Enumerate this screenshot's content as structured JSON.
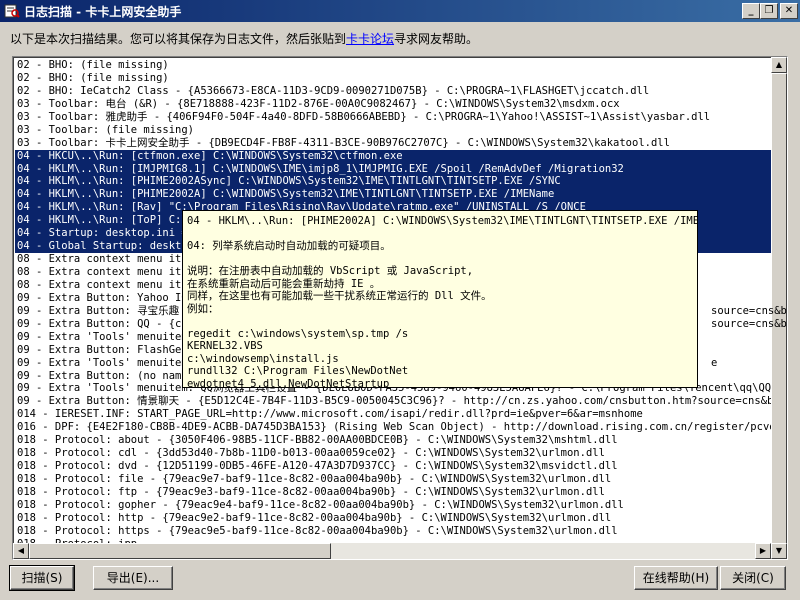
{
  "window": {
    "title": "日志扫描 - 卡卡上网安全助手",
    "minimize_label": "_",
    "restore_label": "❐",
    "close_label": "✕"
  },
  "intro": {
    "text_before": "以下是本次扫描结果。您可以将其保存为日志文件，然后张贴到",
    "link": "卡卡论坛",
    "text_after": "寻求网友帮助。"
  },
  "log_rows": [
    {
      "text": "02 - BHO:  (file missing)",
      "selected": false
    },
    {
      "text": "02 - BHO:  (file missing)",
      "selected": false
    },
    {
      "text": "02 - BHO: IeCatch2 Class - {A5366673-E8CA-11D3-9CD9-0090271D075B} - C:\\PROGRA~1\\FLASHGET\\jccatch.dll",
      "selected": false
    },
    {
      "text": "03 - Toolbar: 电台 (&R) - {8E718888-423F-11D2-876E-00A0C9082467} - C:\\WINDOWS\\System32\\msdxm.ocx",
      "selected": false
    },
    {
      "text": "03 - Toolbar: 雅虎助手 - {406F94F0-504F-4a40-8DFD-58B0666ABEBD} - C:\\PROGRA~1\\Yahoo!\\ASSIST~1\\Assist\\yasbar.dll",
      "selected": false
    },
    {
      "text": "03 - Toolbar:  (file missing)",
      "selected": false
    },
    {
      "text": "03 - Toolbar: 卡卡上网安全助手 - {DB9ECD4F-FB8F-4311-B3CE-90B976C2707C} - C:\\WINDOWS\\System32\\kakatool.dll",
      "selected": false
    },
    {
      "text": "04 - HKCU\\..\\Run: [ctfmon.exe] C:\\WINDOWS\\System32\\ctfmon.exe",
      "selected": true
    },
    {
      "text": "04 - HKLM\\..\\Run: [IMJPMIG8.1] C:\\WINDOWS\\IME\\imjp8_1\\IMJPMIG.EXE /Spoil /RemAdvDef /Migration32",
      "selected": true
    },
    {
      "text": "04 - HKLM\\..\\Run: [PHIME2002ASync] C:\\WINDOWS\\System32\\IME\\TINTLGNT\\TINTSETP.EXE /SYNC",
      "selected": true
    },
    {
      "text": "04 - HKLM\\..\\Run: [PHIME2002A] C:\\WINDOWS\\System32\\IME\\TINTLGNT\\TINTSETP.EXE /IMEName",
      "selected": true
    },
    {
      "text": "04 - HKLM\\..\\Run: [Rav] \"C:\\Program Files\\Rising\\Rav\\Update\\ratmp.exe\" /UNINSTALL /S /ONCE",
      "selected": true
    },
    {
      "text": "04 - HKLM\\..\\Run: [ToP] C:\\",
      "selected": true
    },
    {
      "text": "04 - Startup: desktop.ini =",
      "selected": true
    },
    {
      "text": "04 - Global Startup: deskto",
      "selected": true
    },
    {
      "text": "08 - Extra context menu ite",
      "selected": false
    },
    {
      "text": "08 - Extra context menu ite",
      "selected": false
    },
    {
      "text": "08 - Extra context menu ite",
      "selected": false
    },
    {
      "text": "09 - Extra Button: Yahoo IG",
      "selected": false
    },
    {
      "text": "09 - Extra Button: 寻宝乐趣",
      "selected": false
    },
    {
      "text": "09 - Extra Button: QQ - {c9",
      "selected": false
    },
    {
      "text": "09 - Extra 'Tools' menuitem",
      "selected": false
    },
    {
      "text": "09 - Extra Button: FlashGet",
      "selected": false
    },
    {
      "text": "09 - Extra 'Tools' menuitem",
      "selected": false
    },
    {
      "text": "09 - Extra Button: (no name",
      "selected": false
    },
    {
      "text": "09 - Extra 'Tools' menuitem: QQ浏览器工具栏设置 - {DE0E8B0D-FA35-45d9-9460-4983E5A8AFE6}? - C:\\Program Files\\Tencent\\qq\\QQIEHelp",
      "selected": false
    },
    {
      "text": "09 - Extra Button: 情景聊天 - {E5D12C4E-7B4F-11D3-B5C9-0050045C3C96}? - http://cn.zs.yahoo.com/cnsbutton.htm?source=cns&btn=ya",
      "selected": false
    },
    {
      "text": "014 - IERESET.INF: START_PAGE_URL=http://www.microsoft.com/isapi/redir.dll?prd=ie&pver=6&ar=msnhome",
      "selected": false
    },
    {
      "text": "016 - DPF: {E4E2F180-CB8B-4DE9-ACBB-DA745D3BA153} (Rising Web Scan Object) - http://download.rising.com.cn/register/pcver/auto",
      "selected": false
    },
    {
      "text": "018 - Protocol: about - {3050F406-98B5-11CF-BB82-00AA00BDCE0B} - C:\\WINDOWS\\System32\\mshtml.dll",
      "selected": false
    },
    {
      "text": "018 - Protocol: cdl - {3dd53d40-7b8b-11D0-b013-00aa0059ce02} - C:\\WINDOWS\\System32\\urlmon.dll",
      "selected": false
    },
    {
      "text": "018 - Protocol: dvd - {12D51199-0DB5-46FE-A120-47A3D7D937CC} - C:\\WINDOWS\\System32\\msvidctl.dll",
      "selected": false
    },
    {
      "text": "018 - Protocol: file - {79eac9e7-baf9-11ce-8c82-00aa004ba90b} - C:\\WINDOWS\\System32\\urlmon.dll",
      "selected": false
    },
    {
      "text": "018 - Protocol: ftp - {79eac9e3-baf9-11ce-8c82-00aa004ba90b} - C:\\WINDOWS\\System32\\urlmon.dll",
      "selected": false
    },
    {
      "text": "018 - Protocol: gopher - {79eac9e4-baf9-11ce-8c82-00aa004ba90b} - C:\\WINDOWS\\System32\\urlmon.dll",
      "selected": false
    },
    {
      "text": "018 - Protocol: http - {79eac9e2-baf9-11ce-8c82-00aa004ba90b} - C:\\WINDOWS\\System32\\urlmon.dll",
      "selected": false
    },
    {
      "text": "018 - Protocol: https - {79eac9e5-baf9-11ce-8c82-00aa004ba90b} - C:\\WINDOWS\\System32\\urlmon.dll",
      "selected": false
    },
    {
      "text": "018 - Protocol: ipp -",
      "selected": false
    }
  ],
  "right_overflow": [
    {
      "row": 19,
      "text": "source=cns&bt"
    },
    {
      "row": 20,
      "text": "source=cns&btn="
    },
    {
      "row": 23,
      "text": "e"
    }
  ],
  "tooltip": {
    "lines": [
      "04 - HKLM\\..\\Run: [PHIME2002A] C:\\WINDOWS\\System32\\IME\\TINTLGNT\\TINTSETP.EXE /IMEName",
      "",
      "04: 列举系统启动时自动加载的可疑项目。",
      "",
      "说明：在注册表中自动加载的 VbScript 或 JavaScript,",
      "  在系统重新启动后可能会重新劫持 IE 。",
      "同样，在这里也有可能加载一些干扰系统正常运行的 Dll 文件。",
      "例如：",
      "",
      "regedit c:\\windows\\system\\sp.tmp /s",
      "KERNEL32.VBS",
      "c:\\windowsemp\\install.js",
      "rundll32 C:\\Program Files\\NewDotNet",
      "ewdotnet4_5.dll,NewDotNetStartup"
    ]
  },
  "buttons": {
    "scan": "扫描(S)",
    "export": "导出(E)...",
    "online_help": "在线帮助(H)",
    "close": "关闭(C)"
  }
}
